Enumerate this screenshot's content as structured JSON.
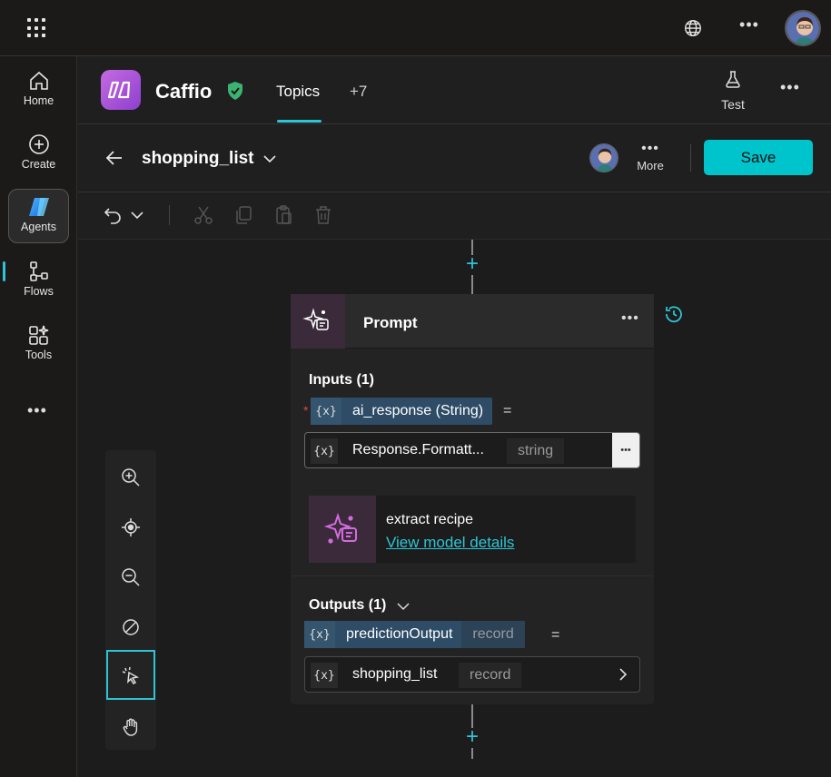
{
  "rail": {
    "items": [
      {
        "label": "Home",
        "icon": "home-icon"
      },
      {
        "label": "Create",
        "icon": "plus-circle-icon"
      },
      {
        "label": "Agents",
        "icon": "agents-icon"
      },
      {
        "label": "Flows",
        "icon": "flows-icon"
      },
      {
        "label": "Tools",
        "icon": "tools-icon"
      }
    ],
    "more": "•••"
  },
  "topbar": {
    "more": "•••"
  },
  "app": {
    "name": "Caffio",
    "tabs": [
      {
        "label": "Topics"
      },
      {
        "label": "+7"
      }
    ],
    "test_label": "Test",
    "more": "•••"
  },
  "topic": {
    "title": "shopping_list",
    "more_label": "More",
    "more_dots": "•••",
    "save_label": "Save"
  },
  "card": {
    "title": "Prompt",
    "more": "•••",
    "inputs_title": "Inputs (1)",
    "required_mark": "*",
    "input_var": {
      "x": "{x}",
      "name": "ai_response (String)",
      "eq": "="
    },
    "input_field": {
      "x": "{x}",
      "name": "Response.Formatt...",
      "type": "string",
      "more": "•••"
    },
    "model": {
      "name": "extract recipe",
      "link": "View model details"
    },
    "outputs_title": "Outputs (1)",
    "output_var": {
      "x": "{x}",
      "name": "predictionOutput",
      "type": "record",
      "eq": "="
    },
    "output_field": {
      "x": "{x}",
      "name": "shopping_list",
      "type": "record"
    }
  },
  "canvas": {
    "plus": "+"
  },
  "colors": {
    "accent": "#00c4cc",
    "link": "#2ec4d6",
    "brand_purple": "#b45de0",
    "shield_green": "#3cb371"
  }
}
